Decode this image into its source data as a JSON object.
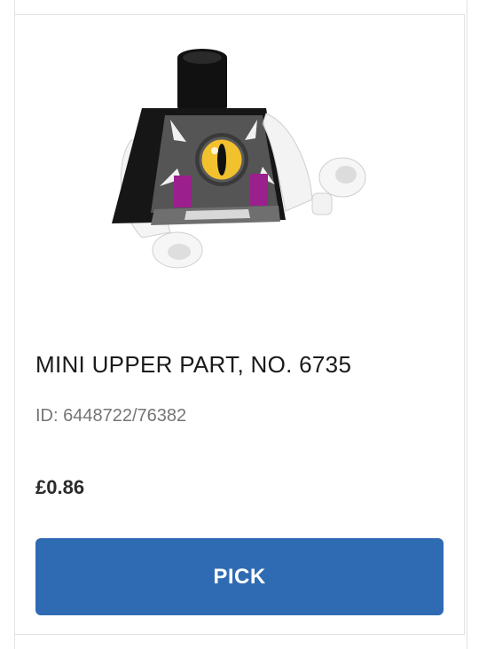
{
  "product": {
    "title": "MINI UPPER PART, NO. 6735",
    "id_text": "ID: 6448722/76382",
    "price": "£0.86",
    "pick_label": "PICK"
  },
  "colors": {
    "button_bg": "#2f6bb2",
    "button_text": "#ffffff",
    "title": "#1a1a1a",
    "id_text": "#757575",
    "price": "#2b2b2b",
    "border": "#e2e2e2"
  }
}
